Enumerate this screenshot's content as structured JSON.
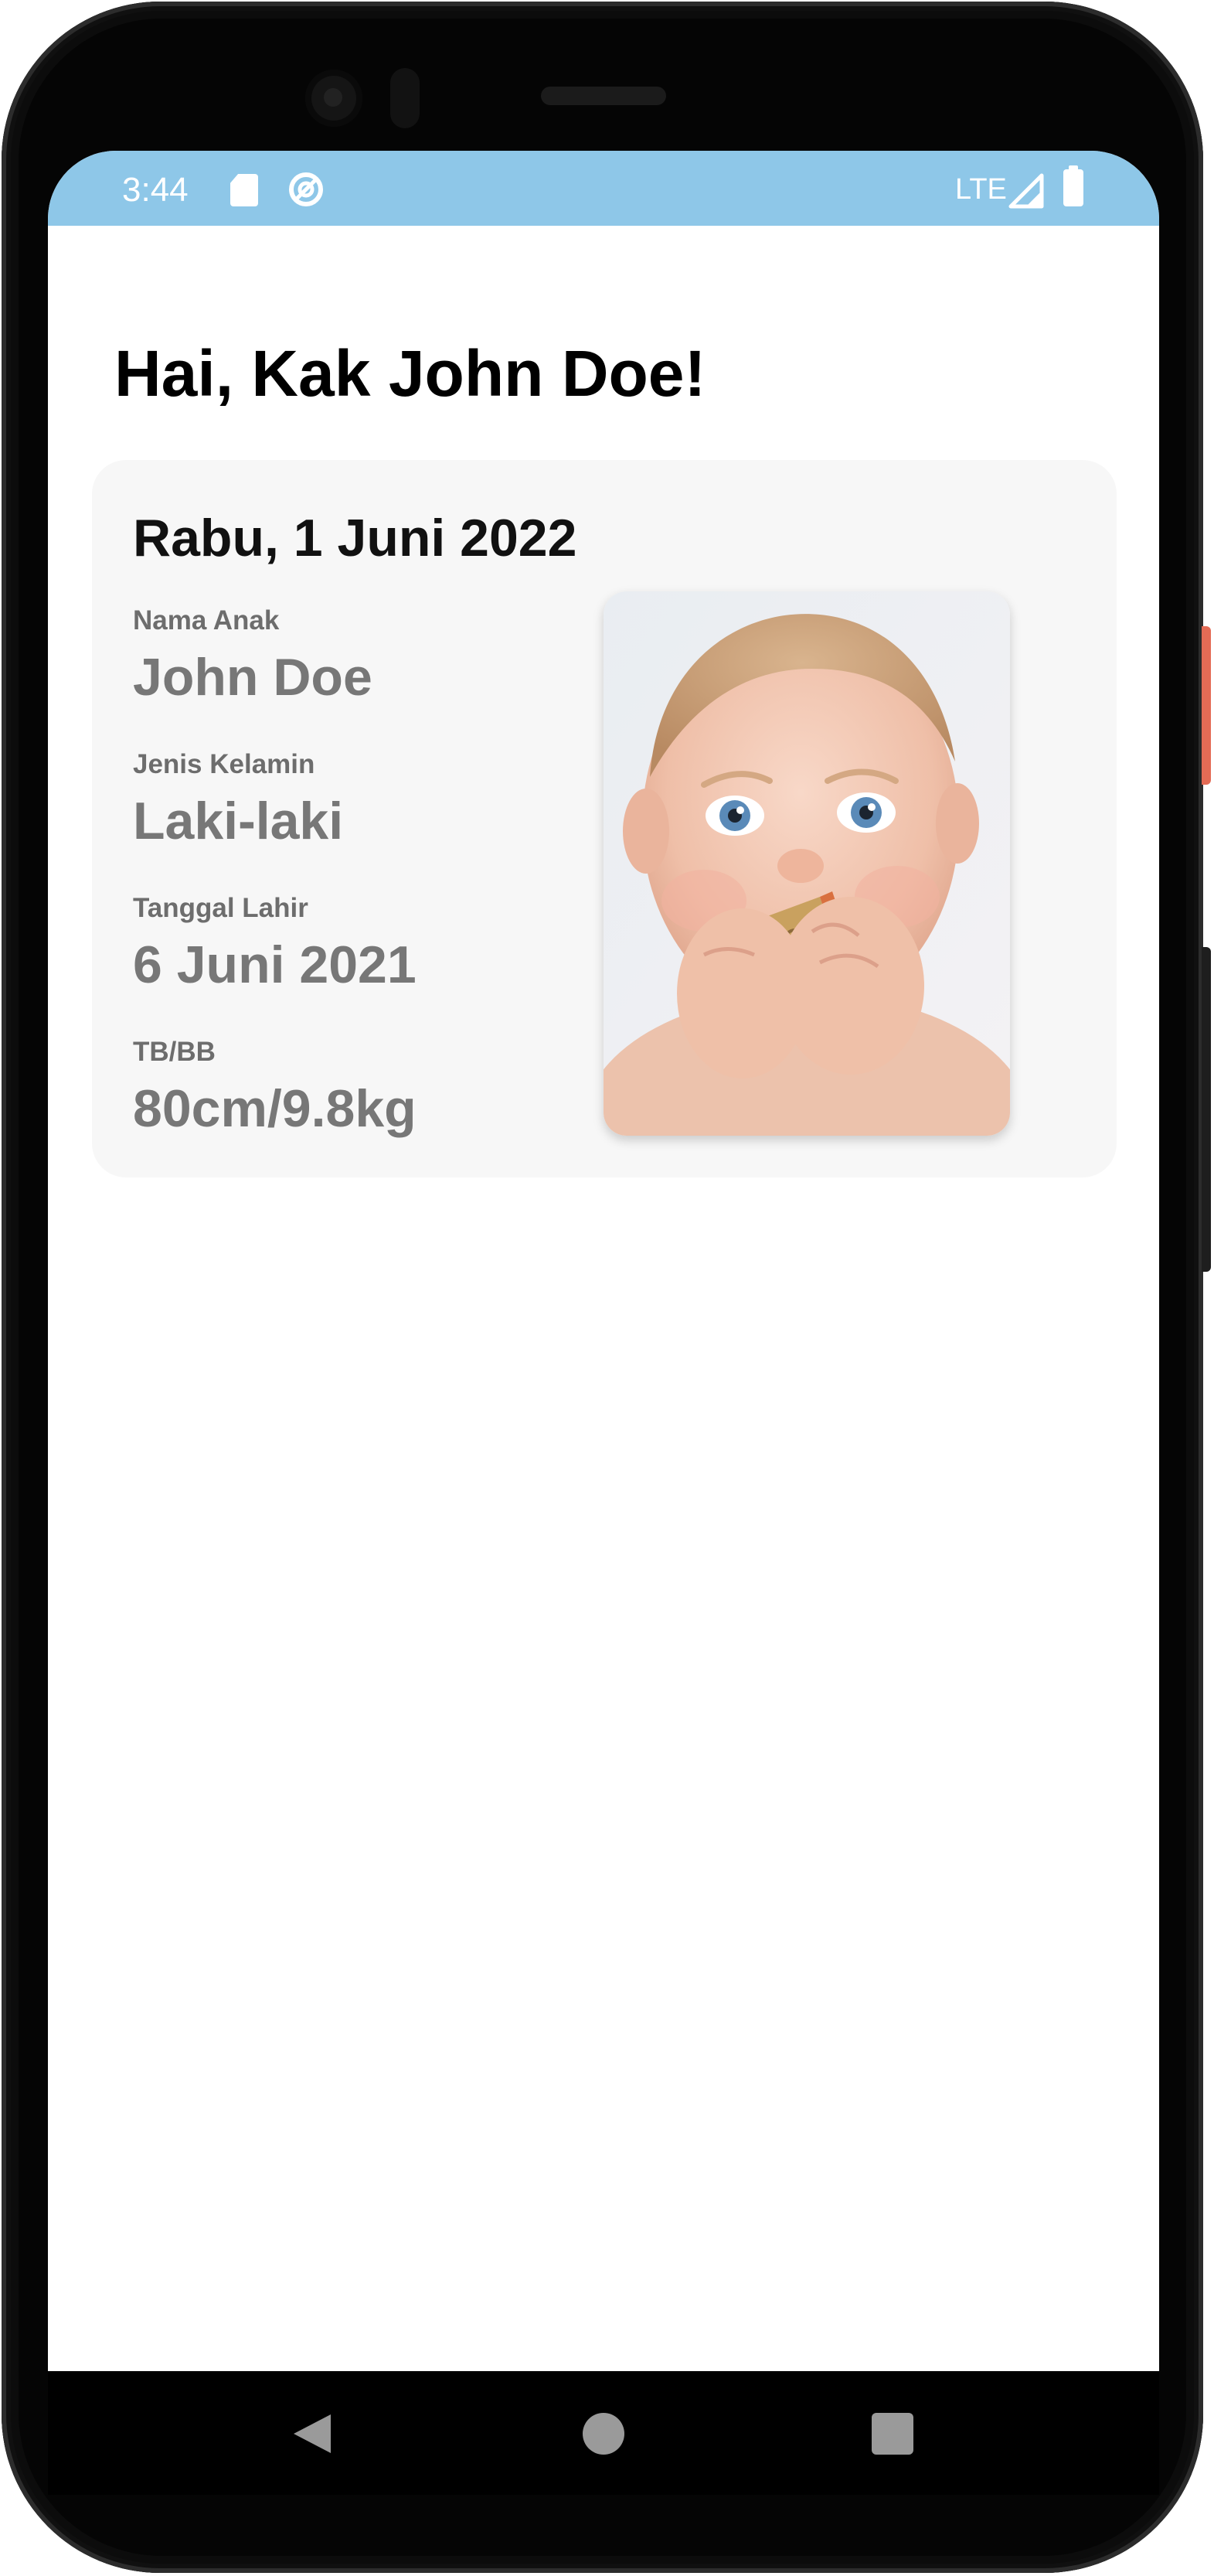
{
  "status_bar": {
    "time": "3:44",
    "network": "LTE",
    "background_color": "#8ec7e8",
    "icons": [
      "sd-card-icon",
      "sync-icon",
      "signal-icon",
      "battery-icon"
    ]
  },
  "greeting": "Hai, Kak John Doe!",
  "card": {
    "date": "Rabu, 1 Juni 2022",
    "fields": [
      {
        "label": "Nama Anak",
        "value": "John Doe"
      },
      {
        "label": "Jenis Kelamin",
        "value": "Laki-laki"
      },
      {
        "label": "Tanggal Lahir",
        "value": "6 Juni 2021"
      },
      {
        "label": "TB/BB",
        "value": "80cm/9.8kg"
      }
    ],
    "photo": "child-photo"
  },
  "nav_bar": {
    "buttons": [
      "back-icon",
      "home-icon",
      "recents-icon"
    ]
  }
}
